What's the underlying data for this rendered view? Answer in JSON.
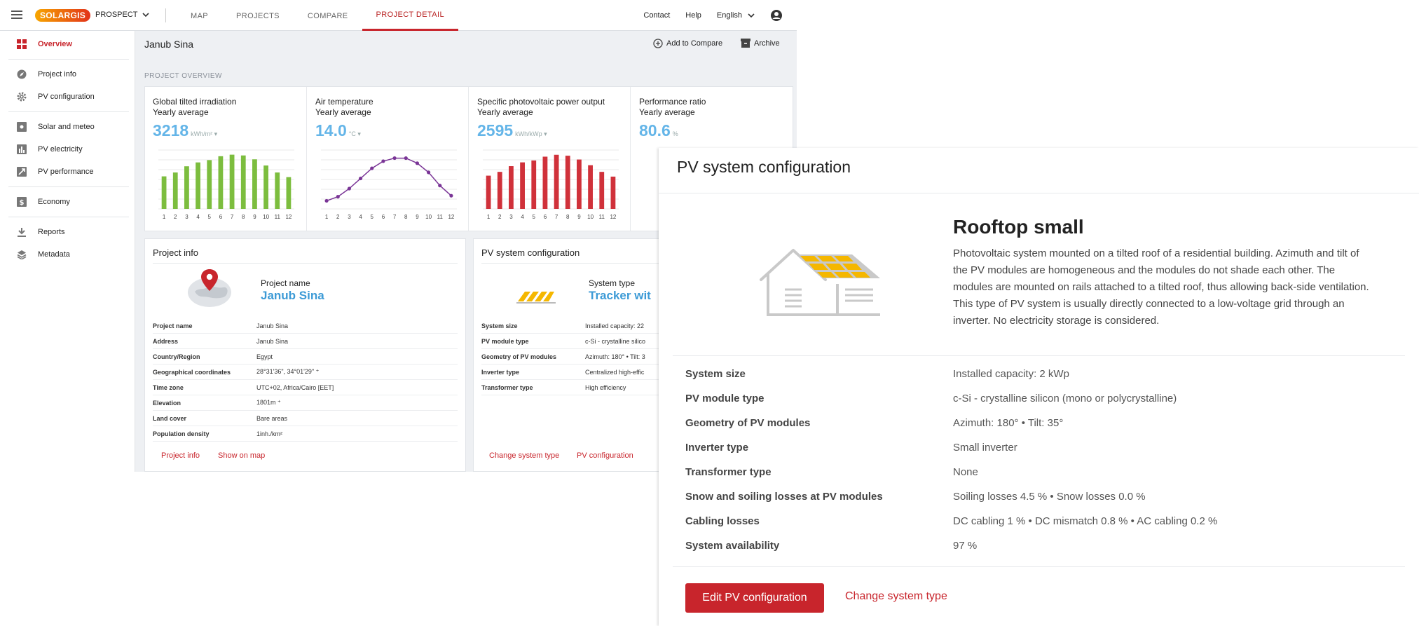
{
  "app": {
    "logo": "SOLARGIS",
    "product": "PROSPECT"
  },
  "nav": [
    "MAP",
    "PROJECTS",
    "COMPARE",
    "PROJECT DETAIL"
  ],
  "top_right": {
    "contact": "Contact",
    "help": "Help",
    "language": "English"
  },
  "sidebar": [
    {
      "label": "Overview",
      "icon": "grid-icon"
    },
    {
      "label": "Project info",
      "icon": "compass-icon"
    },
    {
      "label": "PV configuration",
      "icon": "gear-icon"
    },
    {
      "label": "Solar and meteo",
      "icon": "sun-icon"
    },
    {
      "label": "PV electricity",
      "icon": "bar-chart-icon"
    },
    {
      "label": "PV performance",
      "icon": "trend-icon"
    },
    {
      "label": "Economy",
      "icon": "dollar-icon"
    },
    {
      "label": "Reports",
      "icon": "download-icon"
    },
    {
      "label": "Metadata",
      "icon": "layers-icon"
    }
  ],
  "header": {
    "title": "Janub Sina",
    "add_compare": "Add to Compare",
    "archive": "Archive"
  },
  "section_label": "PROJECT OVERVIEW",
  "metrics": [
    {
      "label": "Global tilted irradiation",
      "sub": "Yearly average",
      "value": "3218",
      "unit": "kWh/m² ▾",
      "color": "#7cbd3e"
    },
    {
      "label": "Air temperature",
      "sub": "Yearly average",
      "value": "14.0",
      "unit": "°C ▾",
      "color": "#7a3596"
    },
    {
      "label": "Specific photovoltaic power output",
      "sub": "Yearly average",
      "value": "2595",
      "unit": "kWh/kWp ▾",
      "color": "#d0313a"
    },
    {
      "label": "Performance ratio",
      "sub": "Yearly average",
      "value": "80.6",
      "unit": "%",
      "color": "#3a4a7a"
    }
  ],
  "chart_data": [
    {
      "type": "bar",
      "categories": [
        "1",
        "2",
        "3",
        "4",
        "5",
        "6",
        "7",
        "8",
        "9",
        "10",
        "11",
        "12"
      ],
      "values": [
        210,
        235,
        275,
        300,
        315,
        340,
        350,
        345,
        320,
        280,
        235,
        205
      ],
      "ylim": [
        0,
        380
      ]
    },
    {
      "type": "line",
      "categories": [
        "1",
        "2",
        "3",
        "4",
        "5",
        "6",
        "7",
        "8",
        "9",
        "10",
        "11",
        "12"
      ],
      "values": [
        2.0,
        4.0,
        8.0,
        13.0,
        18.0,
        21.5,
        23.0,
        23.0,
        20.5,
        16.0,
        9.5,
        4.5
      ],
      "ylim": [
        -2,
        27
      ]
    },
    {
      "type": "bar",
      "categories": [
        "1",
        "2",
        "3",
        "4",
        "5",
        "6",
        "7",
        "8",
        "9",
        "10",
        "11",
        "12"
      ],
      "values": [
        175,
        195,
        225,
        245,
        255,
        275,
        285,
        280,
        260,
        230,
        195,
        170
      ],
      "ylim": [
        0,
        310
      ]
    }
  ],
  "project_info": {
    "title": "Project info",
    "name_label": "Project name",
    "name_value": "Janub Sina",
    "rows": [
      {
        "k": "Project name",
        "v": "Janub Sina"
      },
      {
        "k": "Address",
        "v": "Janub Sina"
      },
      {
        "k": "Country/Region",
        "v": "Egypt"
      },
      {
        "k": "Geographical coordinates",
        "v": "28°31'36\", 34°01'29\" ⁺"
      },
      {
        "k": "Time zone",
        "v": "UTC+02, Africa/Cairo [EET]"
      },
      {
        "k": "Elevation",
        "v": "1801m ⁺"
      },
      {
        "k": "Land cover",
        "v": "Bare areas"
      },
      {
        "k": "Population density",
        "v": "1inh./km²"
      }
    ],
    "link1": "Project info",
    "link2": "Show on map"
  },
  "pv_card": {
    "title": "PV system configuration",
    "type_label": "System type",
    "type_value": "Tracker wit",
    "rows": [
      {
        "k": "System size",
        "v": "Installed capacity: 22"
      },
      {
        "k": "PV module type",
        "v": "c-Si - crystalline silico"
      },
      {
        "k": "Geometry of PV modules",
        "v": "Azimuth: 180° • Tilt: 3"
      },
      {
        "k": "Inverter type",
        "v": "Centralized high-effic"
      },
      {
        "k": "Transformer type",
        "v": "High efficiency"
      }
    ],
    "link1": "Change system type",
    "link2": "PV configuration"
  },
  "panel": {
    "title": "PV system configuration",
    "system_name": "Rooftop small",
    "description": "Photovoltaic system mounted on a tilted roof of a residential building. Azimuth and tilt of the PV modules are homogeneous and the modules do not shade each other. The modules are mounted on rails attached to a tilted roof, thus allowing back-side ventilation. This type of PV system is usually directly connected to a low-voltage grid through an inverter. No electricity storage is considered.",
    "rows": [
      {
        "k": "System size",
        "v": "Installed capacity: 2 kWp"
      },
      {
        "k": "PV module type",
        "v": "c-Si - crystalline silicon (mono or polycrystalline)"
      },
      {
        "k": "Geometry of PV modules",
        "v": "Azimuth: 180° • Tilt: 35°"
      },
      {
        "k": "Inverter type",
        "v": "Small inverter"
      },
      {
        "k": "Transformer type",
        "v": "None"
      },
      {
        "k": "Snow and soiling losses at PV modules",
        "v": "Soiling losses 4.5 % • Snow losses 0.0 %"
      },
      {
        "k": "Cabling losses",
        "v": "DC cabling 1 % • DC mismatch 0.8 % • AC cabling 0.2 %"
      },
      {
        "k": "System availability",
        "v": "97 %"
      }
    ],
    "edit_button": "Edit PV configuration",
    "change_link": "Change system type"
  }
}
